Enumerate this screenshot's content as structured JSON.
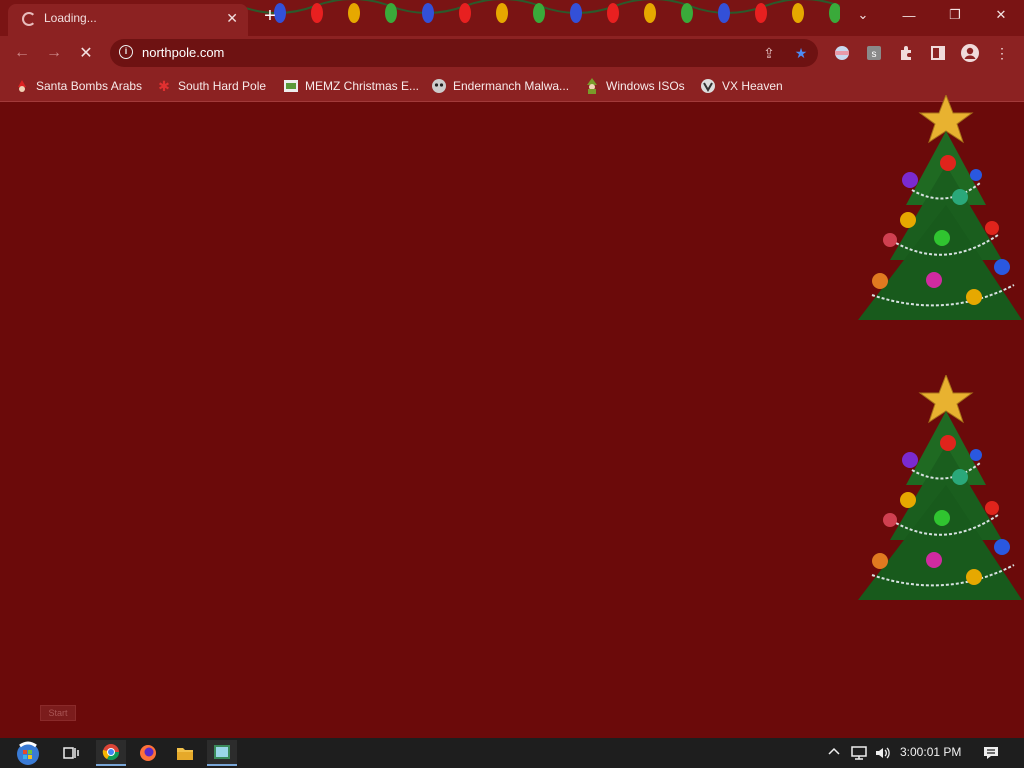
{
  "browser": {
    "tab": {
      "title": "Loading...",
      "close": "✕"
    },
    "new_tab": "+",
    "window_controls": {
      "tab_search": "⌄",
      "minimize": "—",
      "restore": "❐",
      "close": "✕"
    },
    "address_bar": {
      "url": "northpole.com",
      "info": "i"
    },
    "nav": {
      "back": "←",
      "forward": "→",
      "stop": "✕"
    }
  },
  "bookmarks": [
    {
      "label": "Santa Bombs Arabs",
      "icon": "santa-icon"
    },
    {
      "label": "South Hard Pole",
      "icon": "snowflake-icon"
    },
    {
      "label": "MEMZ Christmas E...",
      "icon": "memz-icon"
    },
    {
      "label": "Endermanch Malwa...",
      "icon": "endermanch-icon"
    },
    {
      "label": "Windows ISOs",
      "icon": "elf-icon"
    },
    {
      "label": "VX Heaven",
      "icon": "vx-heaven-icon"
    }
  ],
  "page": {
    "background_color": "#6b0a0a",
    "start_stub": "Start"
  },
  "taskbar": {
    "clock": "3:00:01 PM",
    "apps": [
      "start-button",
      "task-view",
      "chrome",
      "firefox",
      "file-explorer",
      "media-app"
    ]
  }
}
